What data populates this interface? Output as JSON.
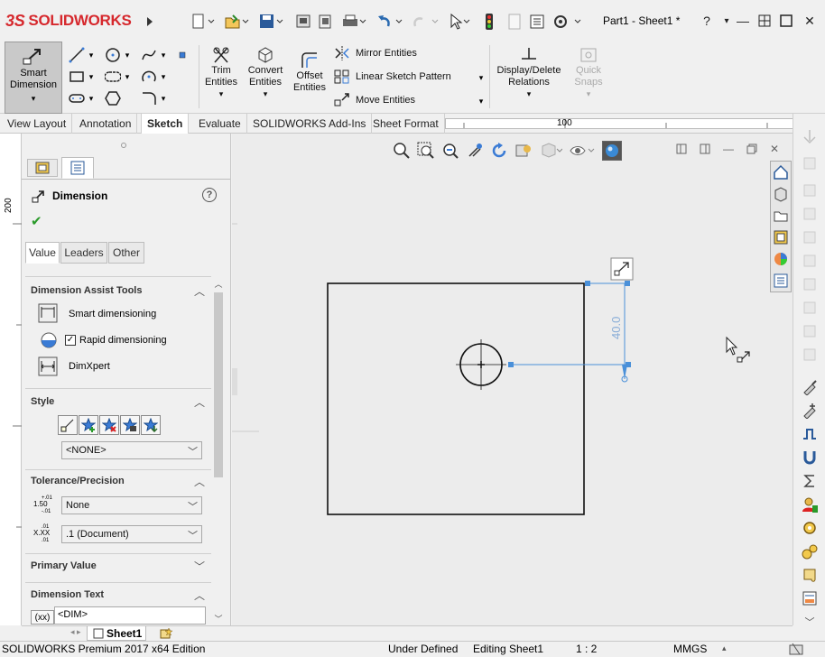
{
  "app": {
    "brand": "SOLIDWORKS",
    "document_title": "Part1 - Sheet1 *"
  },
  "ribbon": {
    "smart_dimension": "Smart Dimension",
    "trim": "Trim Entities",
    "convert": "Convert Entities",
    "offset": "Offset Entities",
    "mirror": "Mirror Entities",
    "linear_pattern": "Linear Sketch Pattern",
    "move": "Move Entities",
    "display_delete": "Display/Delete Relations",
    "quick_snaps": "Quick Snaps"
  },
  "tabs": [
    {
      "label": "View Layout"
    },
    {
      "label": "Annotation"
    },
    {
      "label": "Sketch",
      "active": true
    },
    {
      "label": "Evaluate"
    },
    {
      "label": "SOLIDWORKS Add-Ins"
    },
    {
      "label": "Sheet Format"
    }
  ],
  "rulers": {
    "top_label": "100",
    "left_label": "200"
  },
  "panel": {
    "title": "Dimension",
    "subtabs": [
      "Value",
      "Leaders",
      "Other"
    ],
    "dimension_assist": {
      "header": "Dimension Assist Tools",
      "smart": "Smart dimensioning",
      "rapid": "Rapid dimensioning",
      "dimxpert": "DimXpert"
    },
    "style": {
      "header": "Style",
      "value": "<NONE>"
    },
    "tolerance": {
      "header": "Tolerance/Precision",
      "tolerance_value": "None",
      "precision_value": ".1 (Document)"
    },
    "primary_value": {
      "header": "Primary Value"
    },
    "dimension_text": {
      "header": "Dimension Text",
      "value": "<DIM>"
    }
  },
  "drawing": {
    "dimension_value": "40.0"
  },
  "sheet_tabs": {
    "active": "Sheet1"
  },
  "status": {
    "edition": "SOLIDWORKS Premium 2017 x64 Edition",
    "state": "Under Defined",
    "editing": "Editing Sheet1",
    "scale": "1 : 2",
    "units": "MMGS"
  },
  "colors": {
    "accent_red": "#d6282d",
    "dimension_blue": "#4a90d9",
    "canvas": "#ececec"
  }
}
